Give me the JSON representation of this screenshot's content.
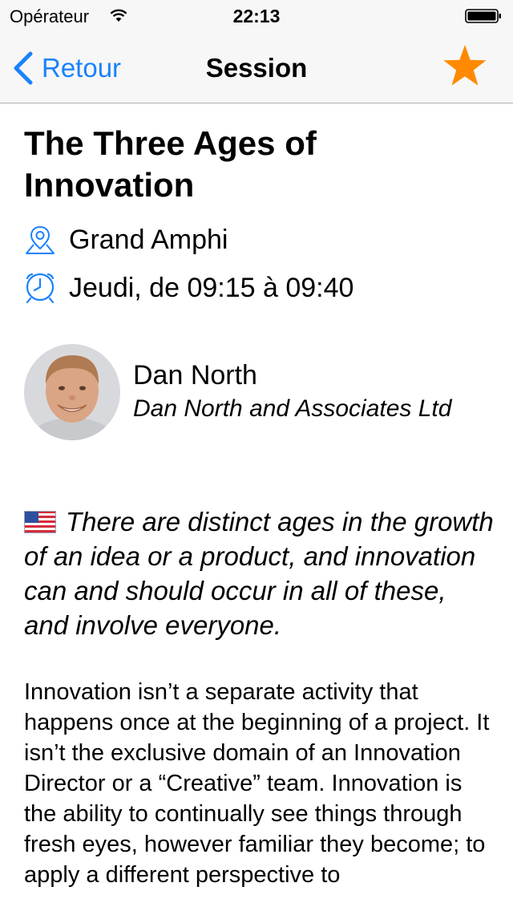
{
  "status_bar": {
    "carrier": "Opérateur",
    "time": "22:13"
  },
  "nav": {
    "back_label": "Retour",
    "title": "Session",
    "favorite_icon": "star-icon"
  },
  "session": {
    "title": "The Three Ages of Innovation",
    "room": "Grand Amphi",
    "schedule": "Jeudi, de 09:15 à 09:40",
    "language_flag": "us-flag-icon",
    "summary": "There are distinct ages in the growth of an idea or a product, and innovation can and should occur in all of these, and involve everyone.",
    "description": "Innovation isn’t a separate activity that happens once at the beginning of a project. It isn’t the exclusive domain of an Innovation Director or a “Creative” team. Innovation is the ability to continually see things through fresh eyes, however familiar they become; to apply a different perspective to"
  },
  "speaker": {
    "name": "Dan North",
    "company": "Dan North and Associates Ltd"
  },
  "colors": {
    "accent": "#1a82fb",
    "star": "#ff8a00"
  }
}
